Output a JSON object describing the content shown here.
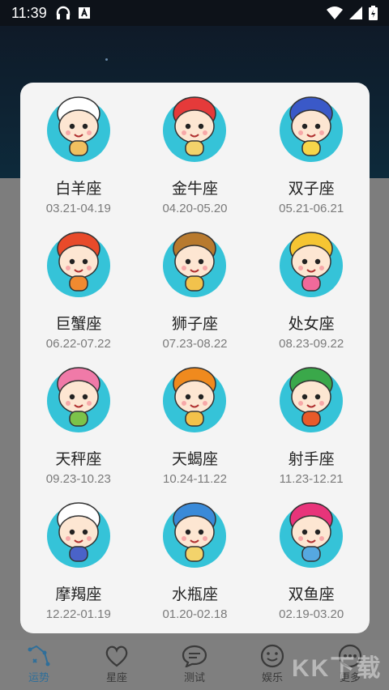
{
  "status": {
    "time": "11:39"
  },
  "zodiac": [
    {
      "name": "白羊座",
      "dates": "03.21-04.19",
      "hair": "#ffffff",
      "accent": "#f0c060"
    },
    {
      "name": "金牛座",
      "dates": "04.20-05.20",
      "hair": "#e53a3a",
      "accent": "#f3d36b"
    },
    {
      "name": "双子座",
      "dates": "05.21-06.21",
      "hair": "#3a59c8",
      "accent": "#f7d54a"
    },
    {
      "name": "巨蟹座",
      "dates": "06.22-07.22",
      "hair": "#e84a2a",
      "accent": "#f08a30"
    },
    {
      "name": "狮子座",
      "dates": "07.23-08.22",
      "hair": "#b87a2e",
      "accent": "#f2c24c"
    },
    {
      "name": "处女座",
      "dates": "08.23-09.22",
      "hair": "#f5c533",
      "accent": "#f06a9a"
    },
    {
      "name": "天秤座",
      "dates": "09.23-10.23",
      "hair": "#f07aa8",
      "accent": "#7cc34a"
    },
    {
      "name": "天蝎座",
      "dates": "10.24-11.22",
      "hair": "#f08a1e",
      "accent": "#f3c24a"
    },
    {
      "name": "射手座",
      "dates": "11.23-12.21",
      "hair": "#3aa84a",
      "accent": "#e85a2a"
    },
    {
      "name": "摩羯座",
      "dates": "12.22-01.19",
      "hair": "#ffffff",
      "accent": "#4a63c8"
    },
    {
      "name": "水瓶座",
      "dates": "01.20-02.18",
      "hair": "#3a8ad8",
      "accent": "#f3d36b"
    },
    {
      "name": "双鱼座",
      "dates": "02.19-03.20",
      "hair": "#e8347a",
      "accent": "#56a8e0"
    }
  ],
  "nav": [
    {
      "label": "运势",
      "icon": "fortune-icon"
    },
    {
      "label": "星座",
      "icon": "heart-icon"
    },
    {
      "label": "测试",
      "icon": "chat-icon"
    },
    {
      "label": "娱乐",
      "icon": "smile-icon"
    },
    {
      "label": "更多",
      "icon": "more-icon"
    }
  ]
}
